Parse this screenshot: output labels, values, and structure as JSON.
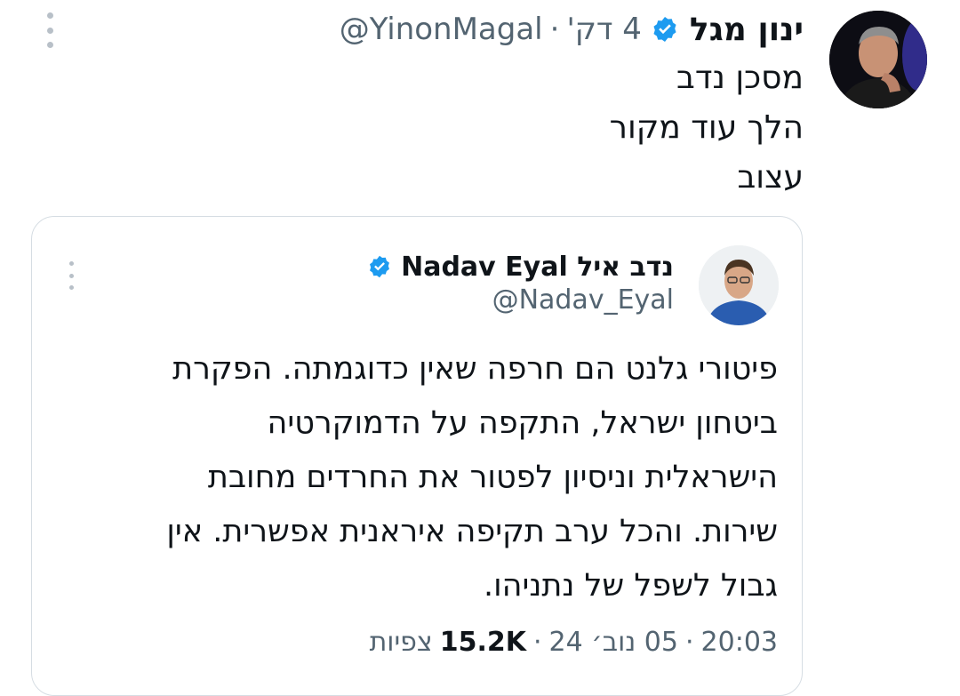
{
  "tweet": {
    "author": {
      "name": "ינון מגל",
      "handle": "@YinonMagal",
      "verified": true,
      "avatar_icon": "avatar-photo"
    },
    "time_ago": "4 דק'",
    "separator": "·",
    "text_lines": [
      "מסכן נדב",
      "הלך עוד מקור",
      "עצוב"
    ]
  },
  "quoted": {
    "author": {
      "name": "נדב איל Nadav Eyal",
      "handle": "@Nadav_Eyal",
      "verified": true,
      "avatar_icon": "avatar-photo"
    },
    "text_lines": [
      "פיטורי גלנט הם חרפה שאין כדוגמתה. הפקרת",
      "ביטחון ישראל, התקפה על הדמוקרטיה",
      "הישראלית וניסיון לפטור את החרדים מחובת",
      "שירות. והכל ערב תקיפה איראנית אפשרית. אין",
      "גבול לשפל של נתניהו."
    ],
    "footer": {
      "time": "20:03",
      "date": "05 נוב׳ 24",
      "views_count": "15.2K",
      "views_label": "צפיות",
      "separator": "·"
    }
  },
  "colors": {
    "verified_blue": "#1d9bf0",
    "secondary_text": "#536471",
    "border": "#d6dde3"
  }
}
